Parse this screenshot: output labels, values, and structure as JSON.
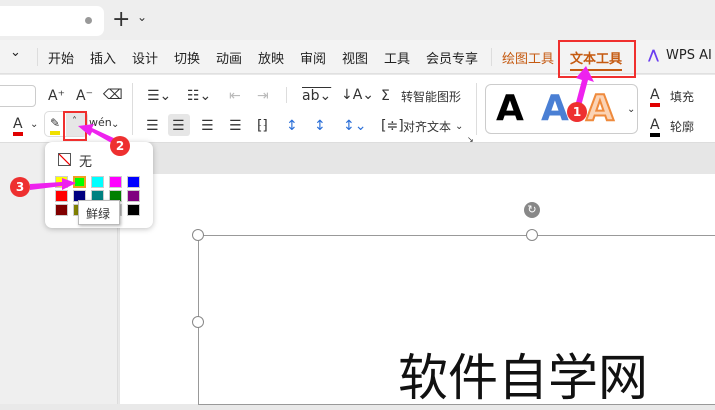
{
  "tabbar": {
    "new_tab": "+",
    "new_tab_menu": "⌄"
  },
  "menu": {
    "collapse": "⌄",
    "items": [
      "开始",
      "插入",
      "设计",
      "切换",
      "动画",
      "放映",
      "审阅",
      "视图",
      "工具",
      "会员专享"
    ],
    "drawing_tools": "绘图工具",
    "text_tools": "文本工具",
    "wps_ai": "WPS AI"
  },
  "ribbon": {
    "smart_shape": "转智能图形",
    "align_text": "对齐文本",
    "fill": "填充",
    "outline": "轮廓",
    "wen": "wén",
    "styles": [
      "A",
      "A",
      "A"
    ]
  },
  "popup": {
    "none": "无",
    "swatches": [
      "#ffff00",
      "#00ff00",
      "#00ffff",
      "#ff00ff",
      "#0000ff",
      "#ff0000",
      "#000080",
      "#008080",
      "#008000",
      "#800080",
      "#800000",
      "#808000",
      "#808080",
      "#c0c0c0",
      "#000000"
    ],
    "tooltip": "鲜绿"
  },
  "slide": {
    "text": "软件自学网"
  },
  "annotations": {
    "b1": "1",
    "b2": "2",
    "b3": "3"
  },
  "colors": {
    "accent": "#c55a11",
    "annot": "#f0302e",
    "arrow": "#ee22ee"
  }
}
